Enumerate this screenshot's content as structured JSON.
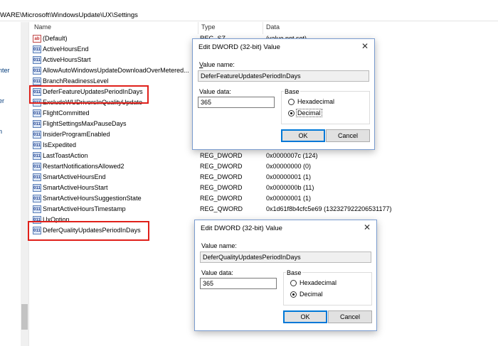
{
  "address_path": "WARE\\Microsoft\\WindowsUpdate\\UX\\Settings",
  "tree_items": [
    "nter",
    "er",
    "n"
  ],
  "columns": {
    "name": "Name",
    "type": "Type",
    "data": "Data"
  },
  "rows": [
    {
      "icon": "ab",
      "name": "(Default)",
      "type": "REG_SZ",
      "data": "(value not set)"
    },
    {
      "icon": "011",
      "name": "ActiveHoursEnd",
      "type": "",
      "data": ""
    },
    {
      "icon": "011",
      "name": "ActiveHoursStart",
      "type": "",
      "data": ""
    },
    {
      "icon": "011",
      "name": "AllowAutoWindowsUpdateDownloadOverMetered...",
      "type": "",
      "data": ""
    },
    {
      "icon": "011",
      "name": "BranchReadinessLevel",
      "type": "",
      "data": ""
    },
    {
      "icon": "011",
      "name": "DeferFeatureUpdatesPeriodInDays",
      "type": "",
      "data": ""
    },
    {
      "icon": "011",
      "name": "ExcludeWUDriversInQualityUpdate",
      "type": "",
      "data": ""
    },
    {
      "icon": "011",
      "name": "FlightCommitted",
      "type": "",
      "data": ""
    },
    {
      "icon": "011",
      "name": "FlightSettingsMaxPauseDays",
      "type": "",
      "data": ""
    },
    {
      "icon": "011",
      "name": "InsiderProgramEnabled",
      "type": "",
      "data": ""
    },
    {
      "icon": "011",
      "name": "IsExpedited",
      "type": "",
      "data": ""
    },
    {
      "icon": "011",
      "name": "LastToastAction",
      "type": "REG_DWORD",
      "data": "0x0000007c (124)"
    },
    {
      "icon": "011",
      "name": "RestartNotificationsAllowed2",
      "type": "REG_DWORD",
      "data": "0x00000000 (0)"
    },
    {
      "icon": "011",
      "name": "SmartActiveHoursEnd",
      "type": "REG_DWORD",
      "data": "0x00000001 (1)"
    },
    {
      "icon": "011",
      "name": "SmartActiveHoursStart",
      "type": "REG_DWORD",
      "data": "0x0000000b (11)"
    },
    {
      "icon": "011",
      "name": "SmartActiveHoursSuggestionState",
      "type": "REG_DWORD",
      "data": "0x00000001 (1)"
    },
    {
      "icon": "011",
      "name": "SmartActiveHoursTimestamp",
      "type": "REG_QWORD",
      "data": "0x1d61f8b4cfc5e69 (132327922206531177)"
    },
    {
      "icon": "011",
      "name": "UxOption",
      "type": "",
      "data": ""
    },
    {
      "icon": "011",
      "name": "DeferQualityUpdatesPeriodInDays",
      "type": "",
      "data": ""
    }
  ],
  "dialog1": {
    "title": "Edit DWORD (32-bit) Value",
    "value_name_label": "Value name:",
    "value_name": "DeferFeatureUpdatesPeriodInDays",
    "value_data_label": "Value data:",
    "value_data": "365",
    "base_label": "Base",
    "hex_label": "Hexadecimal",
    "dec_label": "Decimal",
    "selected_base": "Decimal",
    "ok": "OK",
    "cancel": "Cancel",
    "close": "✕"
  },
  "dialog2": {
    "title": "Edit DWORD (32-bit) Value",
    "value_name_label": "Value name:",
    "value_name": "DeferQualityUpdatesPeriodInDays",
    "value_data_label": "Value data:",
    "value_data": "365",
    "base_label": "Base",
    "hex_label": "Hexadecimal",
    "dec_label": "Decimal",
    "selected_base": "Decimal",
    "ok": "OK",
    "cancel": "Cancel",
    "close": "✕"
  },
  "colors": {
    "highlight": "#e0201a",
    "accent": "#0078d7"
  }
}
